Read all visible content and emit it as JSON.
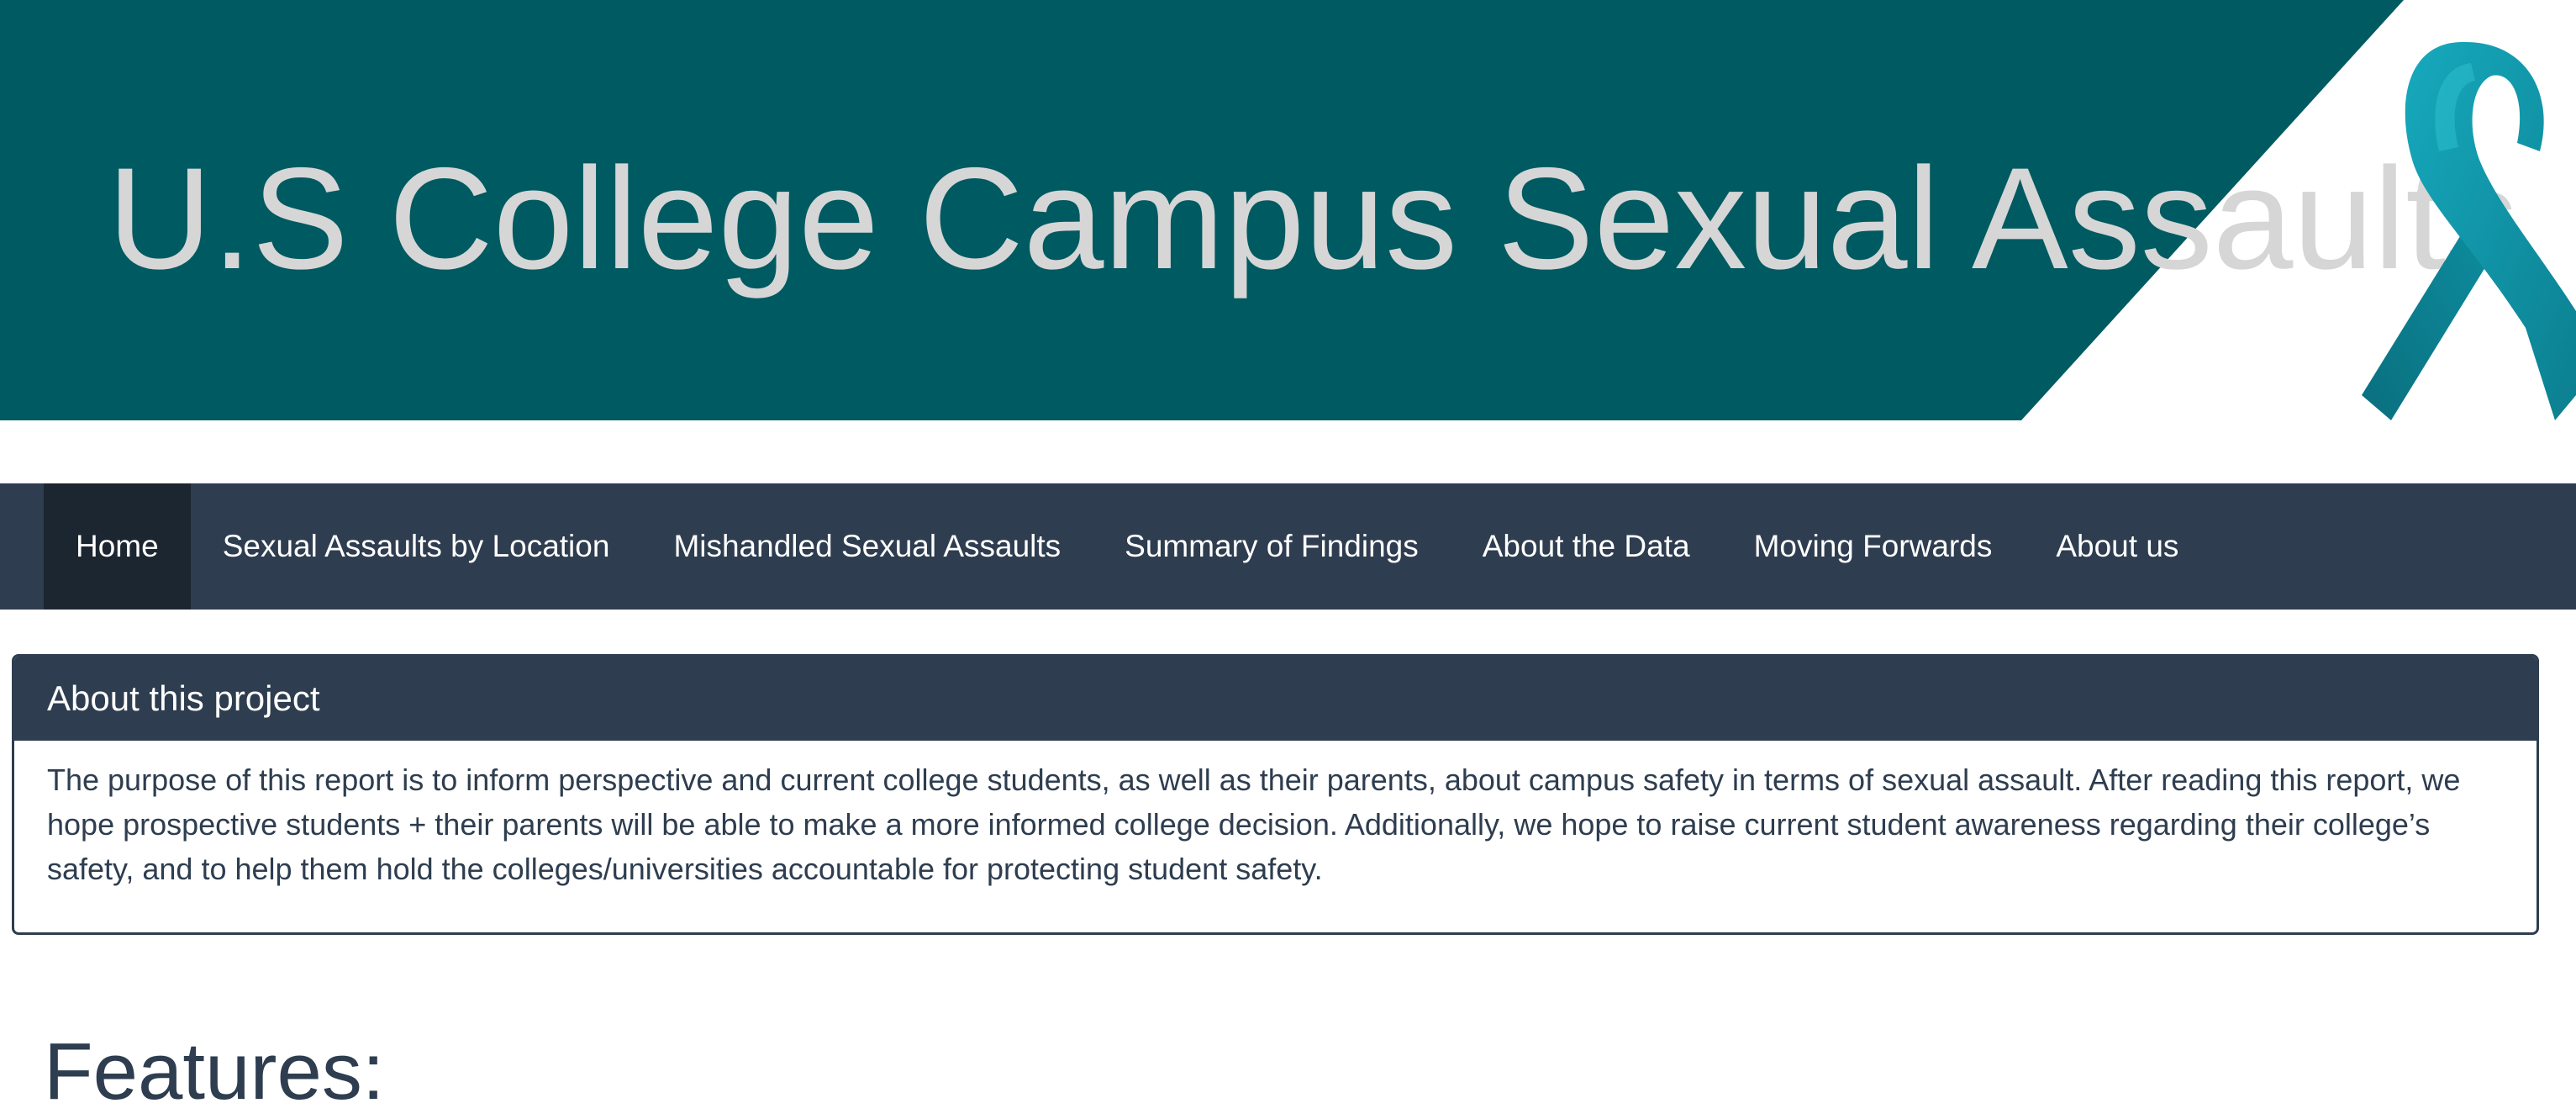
{
  "banner": {
    "title": "U.S College Campus Sexual Assaults",
    "ribbon_icon": "teal-awareness-ribbon-icon",
    "colors": {
      "background": "#005a61",
      "title": "#d6d6d6",
      "ribbon": "#0f98ab"
    }
  },
  "navbar": {
    "items": [
      {
        "label": "Home",
        "active": true
      },
      {
        "label": "Sexual Assaults by Location",
        "active": false
      },
      {
        "label": "Mishandled Sexual Assaults",
        "active": false
      },
      {
        "label": "Summary of Findings",
        "active": false
      },
      {
        "label": "About the Data",
        "active": false
      },
      {
        "label": "Moving Forwards",
        "active": false
      },
      {
        "label": "About us",
        "active": false
      }
    ],
    "colors": {
      "background": "#2e3d4f",
      "active": "#1c2631",
      "text": "#ffffff"
    }
  },
  "panel": {
    "heading": "About this project",
    "body": "The purpose of this report is to inform perspective and current college students, as well as their parents, about campus safety in terms of sexual assault. After reading this report, we hope prospective students + their parents will be able to make a more informed college decision. Additionally, we hope to raise current student awareness regarding their college’s safety, and to help them hold the colleges/universities accountable for protecting student safety."
  },
  "features": {
    "heading": "Features:"
  }
}
